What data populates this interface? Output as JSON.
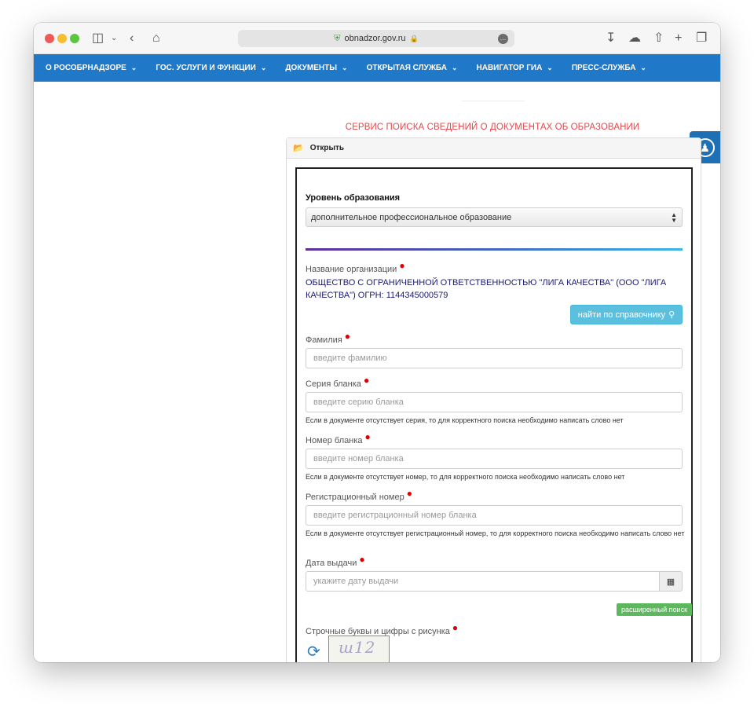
{
  "browser": {
    "url": "obnadzor.gov.ru"
  },
  "nav": {
    "items": [
      {
        "label": "О РОСОБРНАДЗОРЕ"
      },
      {
        "label": "ГОС. УСЛУГИ И ФУНКЦИИ"
      },
      {
        "label": "ДОКУМЕНТЫ"
      },
      {
        "label": "ОТКРЫТАЯ СЛУЖБА"
      },
      {
        "label": "НАВИГАТОР ГИА"
      },
      {
        "label": "ПРЕСС-СЛУЖБА"
      }
    ]
  },
  "page": {
    "heading": "СЕРВИС ПОИСКА СВЕДЕНИЙ О ДОКУМЕНТАХ ОБ ОБРАЗОВАНИИ",
    "panel_toggle": "Открыть"
  },
  "form": {
    "education_level": {
      "label": "Уровень образования",
      "value": "дополнительное профессиональное образование"
    },
    "organization": {
      "label": "Название организации",
      "value": "ОБЩЕСТВО С ОГРАНИЧЕННОЙ ОТВЕТСТВЕННОСТЬЮ \"ЛИГА КАЧЕСТВА\" (ООО \"ЛИГА КАЧЕСТВА\") ОГРН: 1144345000579",
      "button": "найти по справочнику"
    },
    "surname": {
      "label": "Фамилия",
      "placeholder": "введите фамилию"
    },
    "series": {
      "label": "Серия бланка",
      "placeholder": "введите серию бланка",
      "hint": "Если в документе отсутствует серия, то для корректного поиска необходимо написать слово нет"
    },
    "number": {
      "label": "Номер бланка",
      "placeholder": "введите номер бланка",
      "hint": "Если в документе отсутствует номер, то для корректного поиска необходимо написать слово нет"
    },
    "reg_number": {
      "label": "Регистрационный номер",
      "placeholder": "введите регистрационный номер бланка",
      "hint": "Если в документе отсутствует регистрационный номер, то для корректного поиска необходимо написать слово нет"
    },
    "issue_date": {
      "label": "Дата выдачи",
      "placeholder": "укажите дату выдачи"
    },
    "advanced_button": "расширенный поиск",
    "captcha": {
      "label": "Строчные буквы и цифры с рисунка",
      "image_text": "ш12"
    }
  },
  "colors": {
    "nav_bg": "#1f78c8",
    "heading": "#e5484d",
    "reference_button": "#5bc0de",
    "advanced_button": "#5cb85c",
    "required_marker": "#dd0000"
  },
  "icons": [
    "sidebar-icon",
    "back-icon",
    "home-icon",
    "shield-icon",
    "lock-icon",
    "download-icon",
    "cloud-icon",
    "share-icon",
    "plus-icon",
    "tabs-icon",
    "folder-open-icon",
    "accessibility-icon",
    "search-icon",
    "calendar-icon",
    "refresh-icon"
  ]
}
